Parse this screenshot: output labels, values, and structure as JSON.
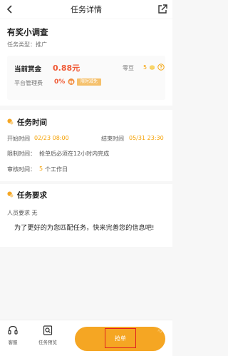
{
  "header": {
    "title": "任务详情"
  },
  "task": {
    "name": "有奖小调查",
    "type_label": "任务类型：",
    "type_value": "推广"
  },
  "reward": {
    "current_label": "当前赏金",
    "current_value": "0.88元",
    "lingdou_label": "零豆",
    "lingdou_value": "5",
    "fee_label": "平台管理费",
    "fee_value": "0%",
    "fee_tag": "限时减免"
  },
  "time_section": {
    "title": "任务时间",
    "start_label": "开始时间",
    "start_value": "02/23 08:00",
    "end_label": "结束时间",
    "end_value": "05/31 23:30",
    "limit_label": "限制时间：",
    "limit_value": "抢单后必须在12小时内完成",
    "review_label": "审核时间：",
    "review_value": "5",
    "review_unit": "个工作日"
  },
  "requirement_section": {
    "title": "任务要求",
    "people_label": "人员要求",
    "people_value": "无",
    "message": "为了更好的为您匹配任务，快来完善您的信息吧!"
  },
  "bottom_bar": {
    "service_label": "客服",
    "preview_label": "任务预览",
    "grab_label": "抢单"
  },
  "colors": {
    "accent": "#f5a623",
    "price": "#f05a36",
    "highlight": "#e02020"
  }
}
